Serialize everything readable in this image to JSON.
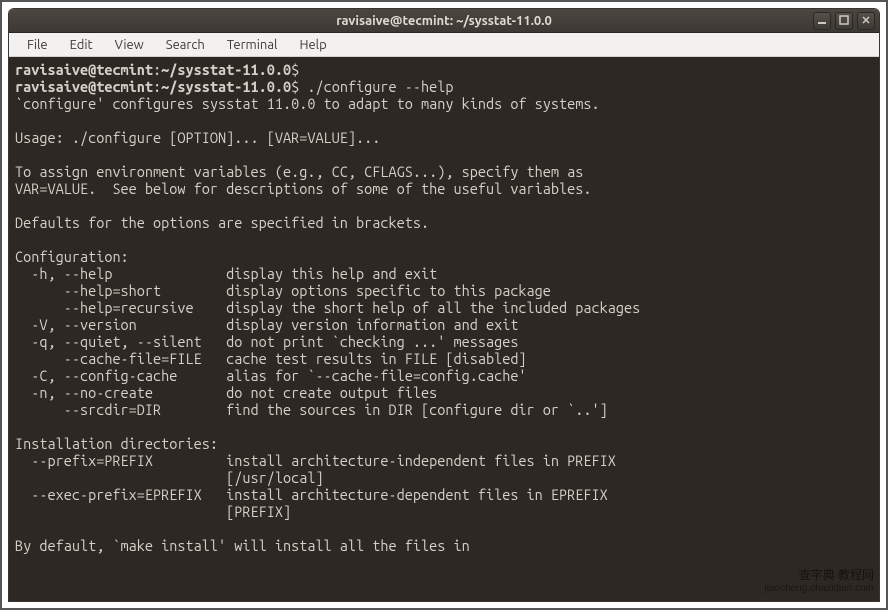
{
  "window": {
    "title": "ravisaive@tecmint: ~/sysstat-11.0.0"
  },
  "menubar": {
    "file": "File",
    "edit": "Edit",
    "view": "View",
    "search": "Search",
    "terminal": "Terminal",
    "help": "Help"
  },
  "terminal": {
    "prompt1_user": "ravisaive@tecmint",
    "prompt1_path": "~/sysstat-11.0.0",
    "prompt1_cmd": "",
    "prompt2_user": "ravisaive@tecmint",
    "prompt2_path": "~/sysstat-11.0.0",
    "prompt2_cmd": "./configure --help",
    "l1": "`configure' configures sysstat 11.0.0 to adapt to many kinds of systems.",
    "l2": "",
    "l3": "Usage: ./configure [OPTION]... [VAR=VALUE]...",
    "l4": "",
    "l5": "To assign environment variables (e.g., CC, CFLAGS...), specify them as",
    "l6": "VAR=VALUE.  See below for descriptions of some of the useful variables.",
    "l7": "",
    "l8": "Defaults for the options are specified in brackets.",
    "l9": "",
    "l10": "Configuration:",
    "l11": "  -h, --help              display this help and exit",
    "l12": "      --help=short        display options specific to this package",
    "l13": "      --help=recursive    display the short help of all the included packages",
    "l14": "  -V, --version           display version information and exit",
    "l15": "  -q, --quiet, --silent   do not print `checking ...' messages",
    "l16": "      --cache-file=FILE   cache test results in FILE [disabled]",
    "l17": "  -C, --config-cache      alias for `--cache-file=config.cache'",
    "l18": "  -n, --no-create         do not create output files",
    "l19": "      --srcdir=DIR        find the sources in DIR [configure dir or `..']",
    "l20": "",
    "l21": "Installation directories:",
    "l22": "  --prefix=PREFIX         install architecture-independent files in PREFIX",
    "l23": "                          [/usr/local]",
    "l24": "  --exec-prefix=EPREFIX   install architecture-dependent files in EPREFIX",
    "l25": "                          [PREFIX]",
    "l26": "",
    "l27": "By default, `make install' will install all the files in"
  },
  "watermark": {
    "main": "查字典 教程网",
    "sub": "jiaocheng.chazidian.com"
  }
}
